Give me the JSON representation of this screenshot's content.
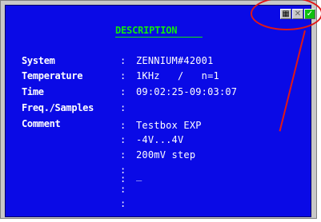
{
  "title": "DESCRIPTION",
  "rows": [
    {
      "label": "System",
      "colon": ":",
      "value": "ZENNIUM#42001"
    },
    {
      "label": "Temperature",
      "colon": ":",
      "value": "1KHz   /   n=1"
    },
    {
      "label": "Time",
      "colon": ":",
      "value": "09:02:25-09:03:07"
    },
    {
      "label": "Freq./Samples",
      "colon": ":",
      "value": ""
    },
    {
      "label": "Comment",
      "colon": ":",
      "value": "Testbox EXP"
    }
  ],
  "comment_lines": [
    {
      "colon": ":",
      "value": "-4V...4V"
    },
    {
      "colon": ":",
      "value": "200mV step"
    },
    {
      "colon": ":",
      "value": ""
    },
    {
      "colon": ":",
      "value": "_"
    },
    {
      "colon": ":",
      "value": ""
    },
    {
      "colon": ":",
      "value": ""
    }
  ],
  "window_buttons": [
    "grid-icon",
    "close-icon",
    "check-icon"
  ],
  "colors": {
    "background": "#0a0ae6",
    "title": "#10e810",
    "highlight": "#e01818"
  }
}
